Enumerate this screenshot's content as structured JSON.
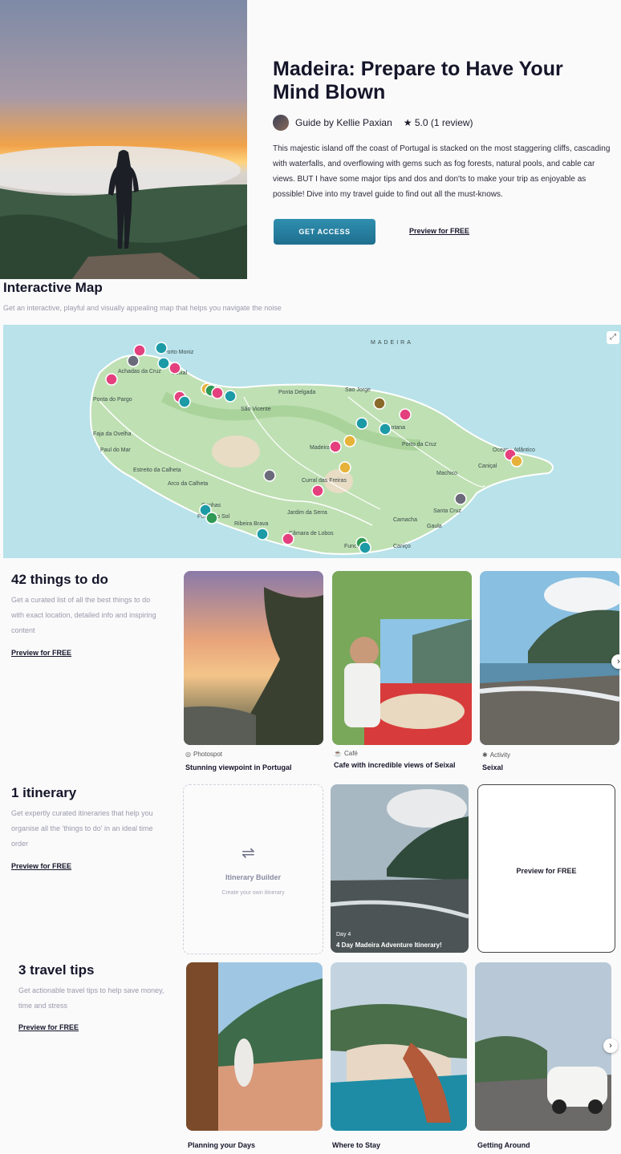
{
  "hero": {
    "title": "Madeira: Prepare to Have Your Mind Blown",
    "guide_by": "Guide by Kellie Paxian",
    "rating": "★ 5.0 (1 review)",
    "description": "This majestic island off the coast of Portugal is stacked on the most staggering cliffs, cascading with waterfalls, and overflowing with gems such as fog forests, natural pools, and cable car views. BUT I have some major tips and dos and don'ts to make your trip as enjoyable as possible! Dive into my travel guide to find out all the must-knows.",
    "cta_label": "GET ACCESS",
    "preview_label": "Preview for FREE"
  },
  "map": {
    "title": "Interactive Map",
    "subtitle": "Get an interactive, playful and visually appealing map that helps you navigate the noise",
    "sea_label": "MADEIRA",
    "places": [
      "Porto Moniz",
      "Achadas da Cruz",
      "Seixal",
      "Ponta do Pargo",
      "Faja da Ovelha",
      "Paul do Mar",
      "Estreito da Calheta",
      "Arco da Calheta",
      "Ponta Delgada",
      "São Vicente",
      "Sao Jorge",
      "Santana",
      "Porto da Cruz",
      "Madeira",
      "Curral das Freiras",
      "Jardim da Serra",
      "Câmara de Lobos",
      "Ribeira Brava",
      "Ponta do Sol",
      "Canhas",
      "Machico",
      "Caniçal",
      "Santa Cruz",
      "Camacha",
      "Gaula",
      "Funchal",
      "Caniço",
      "Oceano Atlântico"
    ]
  },
  "things": {
    "title": "42 things to do",
    "subtitle": "Get a curated list of all the best things to do with exact location, detailed info and inspiring content",
    "preview_label": "Preview for FREE",
    "cards": [
      {
        "category": "Photospot",
        "icon": "camera-icon",
        "title": "Stunning viewpoint in Portugal"
      },
      {
        "category": "Café",
        "icon": "coffee-icon",
        "title": "Cafe with incredible views of Seixal"
      },
      {
        "category": "Activity",
        "icon": "hiker-icon",
        "title": "Seixal"
      }
    ]
  },
  "itinerary": {
    "title": "1 itinerary",
    "subtitle": "Get expertly curated itineraries that help you organise all the 'things to do' in an ideal time order",
    "preview_label": "Preview for FREE",
    "builder_title": "Itinerary Builder",
    "builder_sub": "Create your own itinerary",
    "day_label": "Day 4",
    "day_title": "4 Day Madeira Adventure Itinerary!",
    "preview_card_label": "Preview for FREE"
  },
  "tips": {
    "title": "3 travel tips",
    "subtitle": "Get actionable travel tips to help save money, time and stress",
    "preview_label": "Preview for FREE",
    "cards": [
      {
        "title": "Planning your Days"
      },
      {
        "title": "Where to Stay"
      },
      {
        "title": "Getting Around"
      }
    ]
  },
  "icons": {
    "next": "chevron-right-icon",
    "expand": "expand-icon"
  },
  "colors": {
    "accent": "#1f7a9a",
    "pin_pink": "#e4407e",
    "pin_teal": "#1c9aa6",
    "pin_yellow": "#e6b23a",
    "map_sea": "#b9e2ea",
    "map_land": "#bfe0b3"
  }
}
